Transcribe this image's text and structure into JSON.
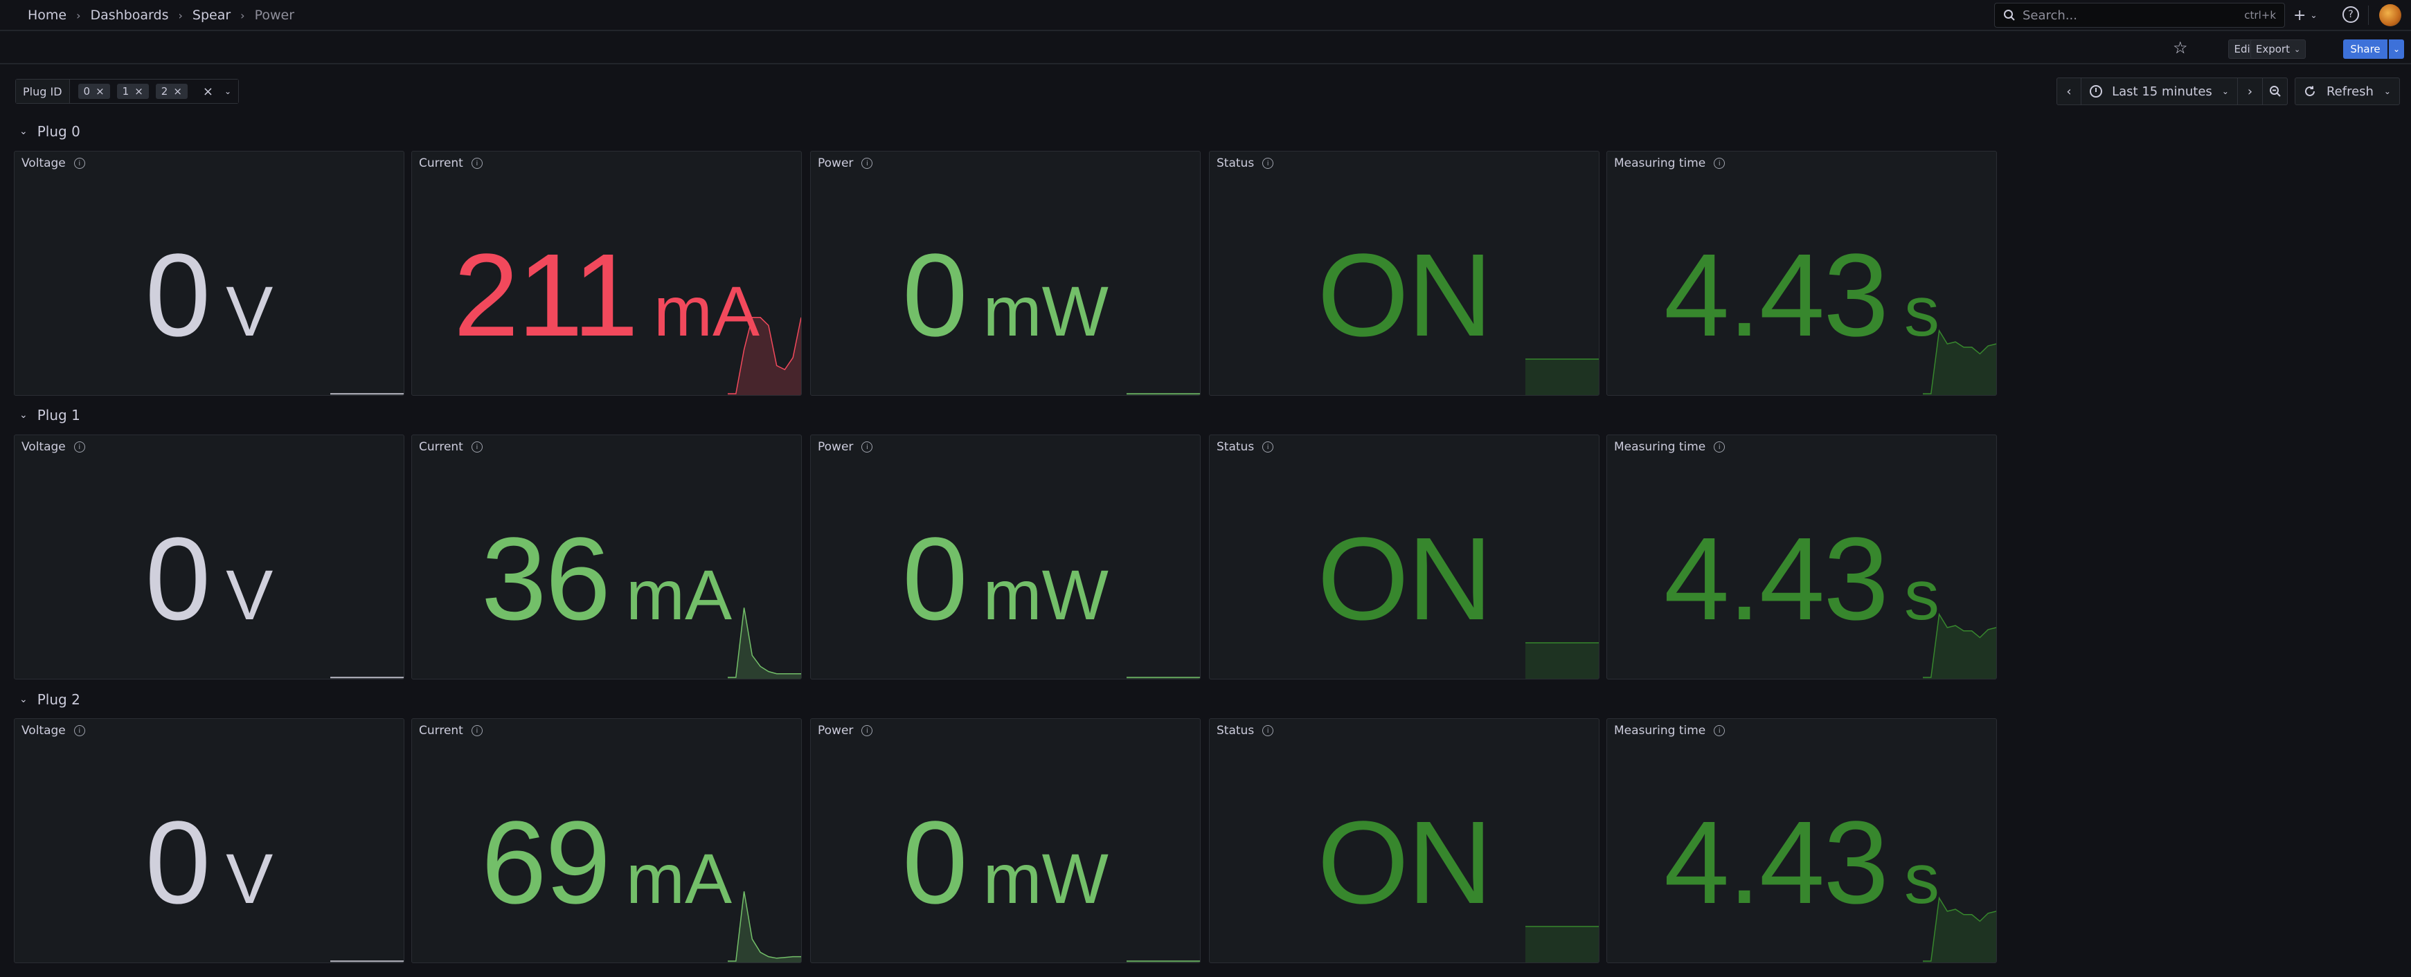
{
  "breadcrumb": [
    "Home",
    "Dashboards",
    "Spear",
    "Power"
  ],
  "search": {
    "placeholder": "Search...",
    "shortcut": "ctrl+k"
  },
  "toolbar": {
    "edit_label": "Edit",
    "export_label": "Export",
    "share_label": "Share"
  },
  "variables": {
    "label": "Plug ID",
    "values": [
      "0",
      "1",
      "2"
    ]
  },
  "time_picker": {
    "range_label": "Last 15 minutes",
    "refresh_label": "Refresh"
  },
  "colors": {
    "red": "#f2495c",
    "light_green": "#73bf69",
    "dark_green": "#37872d",
    "grey": "#d0d0dc",
    "accent_blue": "#3d71d9"
  },
  "rows": [
    {
      "title": "Plug 0",
      "panels": [
        {
          "title": "Voltage",
          "value": "0",
          "unit": "V",
          "color": "grey",
          "spark": [
            0,
            0,
            0,
            0,
            0,
            0,
            0,
            0,
            0,
            0
          ]
        },
        {
          "title": "Current",
          "value": "211",
          "unit": "mA",
          "color": "red",
          "spark": [
            0,
            0,
            0.55,
            0.95,
            0.95,
            0.85,
            0.35,
            0.3,
            0.45,
            0.95
          ]
        },
        {
          "title": "Power",
          "value": "0",
          "unit": "mW",
          "color": "light_green",
          "spark": [
            0,
            0,
            0,
            0,
            0,
            0,
            0,
            0,
            0,
            0
          ]
        },
        {
          "title": "Status",
          "value": "ON",
          "unit": "",
          "color": "dark_green",
          "spark": [
            1,
            1,
            1,
            1,
            1,
            1,
            1,
            1,
            1,
            1
          ]
        },
        {
          "title": "Measuring time",
          "value": "4.43",
          "unit": "s",
          "color": "dark_green",
          "spark": [
            0,
            0,
            0.95,
            0.75,
            0.78,
            0.7,
            0.7,
            0.6,
            0.72,
            0.75
          ]
        }
      ]
    },
    {
      "title": "Plug 1",
      "panels": [
        {
          "title": "Voltage",
          "value": "0",
          "unit": "V",
          "color": "grey",
          "spark": [
            0,
            0,
            0,
            0,
            0,
            0,
            0,
            0,
            0,
            0
          ]
        },
        {
          "title": "Current",
          "value": "36",
          "unit": "mA",
          "color": "light_green",
          "spark": [
            0,
            0,
            0.95,
            0.3,
            0.15,
            0.08,
            0.05,
            0.05,
            0.05,
            0.05
          ]
        },
        {
          "title": "Power",
          "value": "0",
          "unit": "mW",
          "color": "light_green",
          "spark": [
            0,
            0,
            0,
            0,
            0,
            0,
            0,
            0,
            0,
            0
          ]
        },
        {
          "title": "Status",
          "value": "ON",
          "unit": "",
          "color": "dark_green",
          "spark": [
            1,
            1,
            1,
            1,
            1,
            1,
            1,
            1,
            1,
            1
          ]
        },
        {
          "title": "Measuring time",
          "value": "4.43",
          "unit": "s",
          "color": "dark_green",
          "spark": [
            0,
            0,
            0.95,
            0.75,
            0.78,
            0.7,
            0.7,
            0.6,
            0.72,
            0.75
          ]
        }
      ]
    },
    {
      "title": "Plug 2",
      "panels": [
        {
          "title": "Voltage",
          "value": "0",
          "unit": "V",
          "color": "grey",
          "spark": [
            0,
            0,
            0,
            0,
            0,
            0,
            0,
            0,
            0,
            0
          ]
        },
        {
          "title": "Current",
          "value": "69",
          "unit": "mA",
          "color": "light_green",
          "spark": [
            0,
            0,
            0.95,
            0.3,
            0.12,
            0.06,
            0.04,
            0.05,
            0.06,
            0.06
          ]
        },
        {
          "title": "Power",
          "value": "0",
          "unit": "mW",
          "color": "light_green",
          "spark": [
            0,
            0,
            0,
            0,
            0,
            0,
            0,
            0,
            0,
            0
          ]
        },
        {
          "title": "Status",
          "value": "ON",
          "unit": "",
          "color": "dark_green",
          "spark": [
            1,
            1,
            1,
            1,
            1,
            1,
            1,
            1,
            1,
            1
          ]
        },
        {
          "title": "Measuring time",
          "value": "4.43",
          "unit": "s",
          "color": "dark_green",
          "spark": [
            0,
            0,
            0.95,
            0.75,
            0.78,
            0.7,
            0.7,
            0.6,
            0.72,
            0.75
          ]
        }
      ]
    }
  ]
}
